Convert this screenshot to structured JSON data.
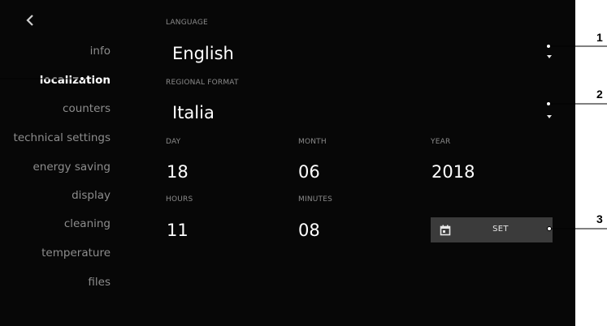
{
  "nav": {
    "items": [
      {
        "label": "info"
      },
      {
        "label": "localization"
      },
      {
        "label": "counters"
      },
      {
        "label": "technical settings"
      },
      {
        "label": "energy saving"
      },
      {
        "label": "display"
      },
      {
        "label": "cleaning"
      },
      {
        "label": "temperature"
      },
      {
        "label": "files"
      }
    ],
    "active": "localization"
  },
  "language": {
    "label": "LANGUAGE",
    "value": "English"
  },
  "regional_format": {
    "label": "REGIONAL FORMAT",
    "value": "Italia"
  },
  "date": {
    "day_label": "DAY",
    "day": "18",
    "month_label": "MONTH",
    "month": "06",
    "year_label": "YEAR",
    "year": "2018"
  },
  "time": {
    "hours_label": "HOURS",
    "hours": "11",
    "minutes_label": "MINUTES",
    "minutes": "08"
  },
  "set_button": {
    "label": "SET",
    "icon": "calendar-icon"
  },
  "callouts": {
    "one": "1",
    "two": "2",
    "three": "3"
  },
  "icons": {
    "back": "chevron-left-icon",
    "dropdown": "caret-down-icon"
  }
}
